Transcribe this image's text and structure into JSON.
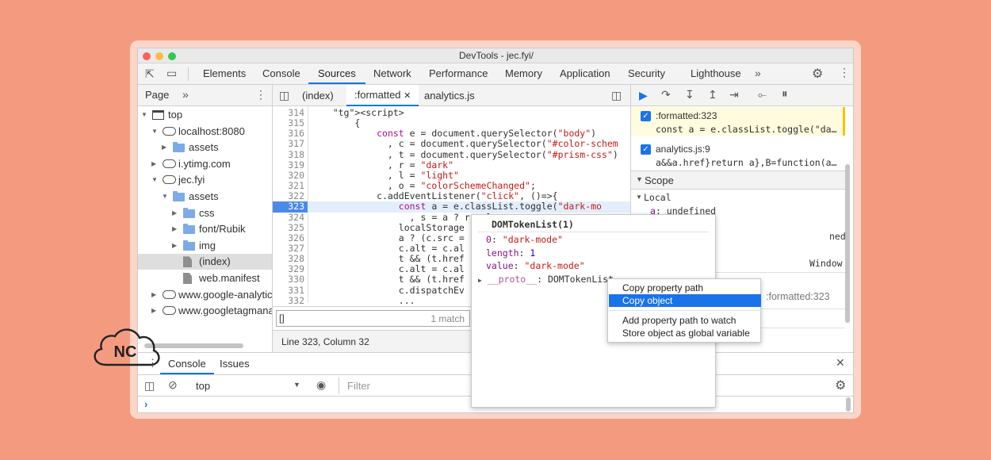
{
  "window": {
    "title": "DevTools - jec.fyi/"
  },
  "tabs": [
    "Elements",
    "Console",
    "Sources",
    "Network",
    "Performance",
    "Memory",
    "Application",
    "Security",
    "Lighthouse"
  ],
  "active_tab": "Sources",
  "navigator": {
    "tabs": [
      "Page"
    ],
    "tree": [
      {
        "label": "top",
        "depth": 0,
        "kind": "frame",
        "open": true
      },
      {
        "label": "localhost:8080",
        "depth": 1,
        "kind": "cloud",
        "open": true
      },
      {
        "label": "assets",
        "depth": 2,
        "kind": "folder",
        "open": false
      },
      {
        "label": "i.ytimg.com",
        "depth": 1,
        "kind": "cloud",
        "open": false
      },
      {
        "label": "jec.fyi",
        "depth": 1,
        "kind": "cloud",
        "open": true
      },
      {
        "label": "assets",
        "depth": 2,
        "kind": "folder",
        "open": true
      },
      {
        "label": "css",
        "depth": 3,
        "kind": "folder",
        "open": false
      },
      {
        "label": "font/Rubik",
        "depth": 3,
        "kind": "folder",
        "open": false
      },
      {
        "label": "img",
        "depth": 3,
        "kind": "folder",
        "open": false
      },
      {
        "label": "(index)",
        "depth": 3,
        "kind": "file",
        "selected": true
      },
      {
        "label": "web.manifest",
        "depth": 3,
        "kind": "file"
      },
      {
        "label": "www.google-analytics",
        "depth": 1,
        "kind": "cloud",
        "open": false
      },
      {
        "label": "www.googletagmanag",
        "depth": 1,
        "kind": "cloud",
        "open": false
      }
    ]
  },
  "editor": {
    "tabs": [
      "(index)",
      ":formatted",
      "analytics.js"
    ],
    "active_tab": ":formatted",
    "search_placeholder": "",
    "search_value": "",
    "match_count": "1 match",
    "status": "Line 323, Column 32"
  },
  "code": [
    {
      "n": "314",
      "t": "    <script>"
    },
    {
      "n": "315",
      "t": "        {"
    },
    {
      "n": "316",
      "t": "            const e = document.querySelector(\"body\")"
    },
    {
      "n": "317",
      "t": "              , c = document.querySelector(\"#color-schem"
    },
    {
      "n": "318",
      "t": "              , t = document.querySelector(\"#prism-css\")"
    },
    {
      "n": "319",
      "t": "              , r = \"dark\""
    },
    {
      "n": "320",
      "t": "              , l = \"light\""
    },
    {
      "n": "321",
      "t": "              , o = \"colorSchemeChanged\";"
    },
    {
      "n": "322",
      "t": "            c.addEventListener(\"click\", ()=>{"
    },
    {
      "n": "323",
      "t": "                const a = e.classList.toggle(\"dark-mo"
    },
    {
      "n": "324",
      "t": "                  , s = a ? r : l;"
    },
    {
      "n": "325",
      "t": "                localStorage"
    },
    {
      "n": "326",
      "t": "                a ? (c.src ="
    },
    {
      "n": "327",
      "t": "                c.alt = c.al"
    },
    {
      "n": "328",
      "t": "                t && (t.href"
    },
    {
      "n": "329",
      "t": "                c.alt = c.al"
    },
    {
      "n": "330",
      "t": "                t && (t.href"
    },
    {
      "n": "331",
      "t": "                c.dispatchEv"
    },
    {
      "n": "332",
      "t": "                ..."
    }
  ],
  "current_line": "323",
  "debugger": {
    "breakpoints": [
      {
        "file": ":formatted:323",
        "code": "const a = e.classList.toggle(\"da…"
      },
      {
        "file": "analytics.js:9",
        "code": "a&&a.href}return a},B=function(a…"
      }
    ],
    "scope_label": "Scope",
    "local_label": "Local",
    "local_var": {
      "name": "a",
      "value": "undefined"
    },
    "partial_value": "ned",
    "window_label": "Window",
    "callstack_item": ":formatted:323"
  },
  "popover": {
    "title": "DOMTokenList(1)",
    "props": [
      {
        "k": "0",
        "v": "\"dark-mode\"",
        "str": true
      },
      {
        "k": "length",
        "v": "1",
        "str": false
      },
      {
        "k": "value",
        "v": "\"dark-mode\"",
        "str": true
      }
    ],
    "proto": {
      "k": "__proto__",
      "v": "DOMTokenList"
    }
  },
  "context_menu": {
    "items": [
      "Copy property path",
      "Copy object",
      "Add property path to watch",
      "Store object as global variable"
    ],
    "selected": "Copy object"
  },
  "drawer": {
    "tabs": [
      "Console",
      "Issues"
    ],
    "context": "top",
    "filter_placeholder": "Filter",
    "prompt": "›"
  },
  "logo": {
    "text": "NC"
  }
}
